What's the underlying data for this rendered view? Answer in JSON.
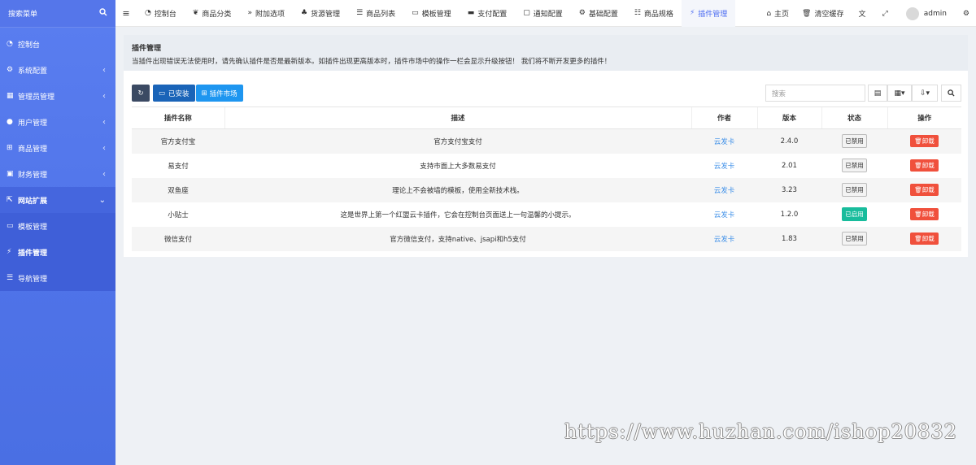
{
  "sidebar": {
    "search_label": "搜索菜单",
    "items": [
      {
        "label": "控制台",
        "icon": "dashboard-icon"
      },
      {
        "label": "系统配置",
        "icon": "cogs-icon"
      },
      {
        "label": "管理员管理",
        "icon": "grid-icon"
      },
      {
        "label": "用户管理",
        "icon": "user-icon"
      },
      {
        "label": "商品管理",
        "icon": "cart-icon"
      },
      {
        "label": "财务管理",
        "icon": "finance-icon"
      },
      {
        "label": "网站扩展",
        "icon": "external-icon"
      }
    ],
    "sub_items": [
      {
        "label": "模板管理",
        "icon": "monitor-icon"
      },
      {
        "label": "插件管理",
        "icon": "plug-icon"
      },
      {
        "label": "导航管理",
        "icon": "sliders-icon"
      }
    ]
  },
  "topbar": {
    "tabs": [
      {
        "label": "控制台",
        "icon": "dashboard-icon"
      },
      {
        "label": "商品分类",
        "icon": "leaf-icon"
      },
      {
        "label": "附加选项",
        "icon": "angle-double-right-icon"
      },
      {
        "label": "货源管理",
        "icon": "sitemap-icon"
      },
      {
        "label": "商品列表",
        "icon": "list-icon"
      },
      {
        "label": "模板管理",
        "icon": "monitor-icon"
      },
      {
        "label": "支付配置",
        "icon": "credit-card-icon"
      },
      {
        "label": "通知配置",
        "icon": "chat-icon"
      },
      {
        "label": "基础配置",
        "icon": "gear-icon"
      },
      {
        "label": "商品规格",
        "icon": "sliders-icon"
      },
      {
        "label": "插件管理",
        "icon": "plug-icon"
      }
    ],
    "home_label": "主页",
    "clear_cache_label": "清空缓存",
    "user_name": "admin"
  },
  "header": {
    "title": "插件管理",
    "description": "当插件出现错误无法使用时，请先确认插件是否是最新版本。如插件出现更高版本时，插件市场中的操作一栏会显示升级按钮！ 我们将不断开发更多的插件！"
  },
  "toolbar": {
    "installed_label": "已安装",
    "market_label": "插件市场",
    "search_placeholder": "搜索"
  },
  "table": {
    "columns": [
      "插件名称",
      "描述",
      "作者",
      "版本",
      "状态",
      "操作"
    ],
    "rows": [
      {
        "name": "官方支付宝",
        "desc": "官方支付宝支付",
        "author": "云发卡",
        "version": "2.4.0",
        "status": "已禁用",
        "enabled": false,
        "action": "卸载"
      },
      {
        "name": "易支付",
        "desc": "支持市面上大多数易支付",
        "author": "云发卡",
        "version": "2.01",
        "status": "已禁用",
        "enabled": false,
        "action": "卸载"
      },
      {
        "name": "双鱼座",
        "desc": "理论上不会被墙的模板，使用全新技术栈。",
        "author": "云发卡",
        "version": "3.23",
        "status": "已禁用",
        "enabled": false,
        "action": "卸载"
      },
      {
        "name": "小贴士",
        "desc": "这是世界上第一个红盟云卡插件，它会在控制台页面送上一句温馨的小提示。",
        "author": "云发卡",
        "version": "1.2.0",
        "status": "已启用",
        "enabled": true,
        "action": "卸载"
      },
      {
        "name": "微信支付",
        "desc": "官方微信支付，支持native、jsapi和h5支付",
        "author": "云发卡",
        "version": "1.83",
        "status": "已禁用",
        "enabled": false,
        "action": "卸载"
      }
    ]
  },
  "watermark": "https://www.huzhan.com/ishop20832",
  "colors": {
    "sidebar": "#5178ec",
    "accent": "#4e6ef2",
    "installed_button": "#1a64b8",
    "market_button": "#1e96f0",
    "enabled_badge": "#18bc9c",
    "uninstall_button": "#f0503c"
  }
}
